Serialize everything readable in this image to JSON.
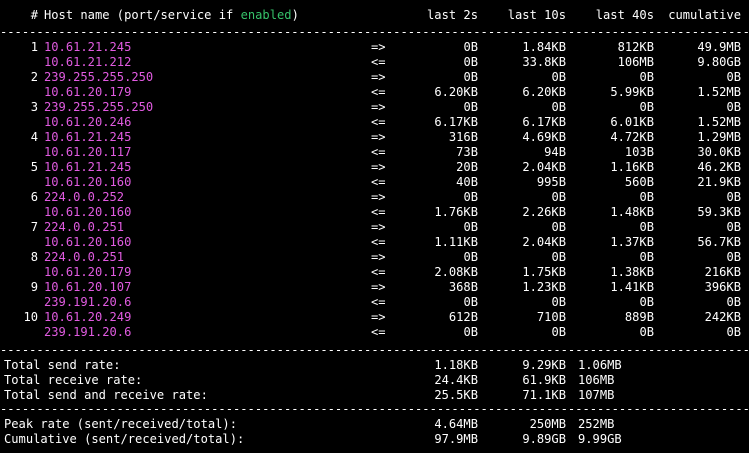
{
  "colors": {
    "background": "#000000",
    "text": "#ffffff",
    "host": "#e05be0",
    "enabled": "#36c26a"
  },
  "header": {
    "num_label": "#",
    "host_label_prefix": "Host name (port/service if ",
    "host_label_enabled": "enabled",
    "host_label_suffix": ")",
    "col_2s": "last 2s",
    "col_10s": "last 10s",
    "col_40s": "last 40s",
    "col_cum": "cumulative"
  },
  "separator": "--------------------------------------------------------------------------------------------------------------------------------------------",
  "connections": [
    {
      "num": "1",
      "src": {
        "host": "10.61.21.245",
        "dir": "=>",
        "l2": "0B",
        "l10": "1.84KB",
        "l40": "812KB",
        "cum": "49.9MB"
      },
      "dst": {
        "host": "10.61.21.212",
        "dir": "<=",
        "l2": "0B",
        "l10": "33.8KB",
        "l40": "106MB",
        "cum": "9.80GB"
      }
    },
    {
      "num": "2",
      "src": {
        "host": "239.255.255.250",
        "dir": "=>",
        "l2": "0B",
        "l10": "0B",
        "l40": "0B",
        "cum": "0B"
      },
      "dst": {
        "host": "10.61.20.179",
        "dir": "<=",
        "l2": "6.20KB",
        "l10": "6.20KB",
        "l40": "5.99KB",
        "cum": "1.52MB"
      }
    },
    {
      "num": "3",
      "src": {
        "host": "239.255.255.250",
        "dir": "=>",
        "l2": "0B",
        "l10": "0B",
        "l40": "0B",
        "cum": "0B"
      },
      "dst": {
        "host": "10.61.20.246",
        "dir": "<=",
        "l2": "6.17KB",
        "l10": "6.17KB",
        "l40": "6.01KB",
        "cum": "1.52MB"
      }
    },
    {
      "num": "4",
      "src": {
        "host": "10.61.21.245",
        "dir": "=>",
        "l2": "316B",
        "l10": "4.69KB",
        "l40": "4.72KB",
        "cum": "1.29MB"
      },
      "dst": {
        "host": "10.61.20.117",
        "dir": "<=",
        "l2": "73B",
        "l10": "94B",
        "l40": "103B",
        "cum": "30.0KB"
      }
    },
    {
      "num": "5",
      "src": {
        "host": "10.61.21.245",
        "dir": "=>",
        "l2": "20B",
        "l10": "2.04KB",
        "l40": "1.16KB",
        "cum": "46.2KB"
      },
      "dst": {
        "host": "10.61.20.160",
        "dir": "<=",
        "l2": "40B",
        "l10": "995B",
        "l40": "560B",
        "cum": "21.9KB"
      }
    },
    {
      "num": "6",
      "src": {
        "host": "224.0.0.252",
        "dir": "=>",
        "l2": "0B",
        "l10": "0B",
        "l40": "0B",
        "cum": "0B"
      },
      "dst": {
        "host": "10.61.20.160",
        "dir": "<=",
        "l2": "1.76KB",
        "l10": "2.26KB",
        "l40": "1.48KB",
        "cum": "59.3KB"
      }
    },
    {
      "num": "7",
      "src": {
        "host": "224.0.0.251",
        "dir": "=>",
        "l2": "0B",
        "l10": "0B",
        "l40": "0B",
        "cum": "0B"
      },
      "dst": {
        "host": "10.61.20.160",
        "dir": "<=",
        "l2": "1.11KB",
        "l10": "2.04KB",
        "l40": "1.37KB",
        "cum": "56.7KB"
      }
    },
    {
      "num": "8",
      "src": {
        "host": "224.0.0.251",
        "dir": "=>",
        "l2": "0B",
        "l10": "0B",
        "l40": "0B",
        "cum": "0B"
      },
      "dst": {
        "host": "10.61.20.179",
        "dir": "<=",
        "l2": "2.08KB",
        "l10": "1.75KB",
        "l40": "1.38KB",
        "cum": "216KB"
      }
    },
    {
      "num": "9",
      "src": {
        "host": "10.61.20.107",
        "dir": "=>",
        "l2": "368B",
        "l10": "1.23KB",
        "l40": "1.41KB",
        "cum": "396KB"
      },
      "dst": {
        "host": "239.191.20.6",
        "dir": "<=",
        "l2": "0B",
        "l10": "0B",
        "l40": "0B",
        "cum": "0B"
      }
    },
    {
      "num": "10",
      "src": {
        "host": "10.61.20.249",
        "dir": "=>",
        "l2": "612B",
        "l10": "710B",
        "l40": "889B",
        "cum": "242KB"
      },
      "dst": {
        "host": "239.191.20.6",
        "dir": "<=",
        "l2": "0B",
        "l10": "0B",
        "l40": "0B",
        "cum": "0B"
      }
    }
  ],
  "totals": [
    {
      "label": "Total send rate:",
      "l2": "1.18KB",
      "l10": "9.29KB",
      "l40": "1.06MB"
    },
    {
      "label": "Total receive rate:",
      "l2": "24.4KB",
      "l10": "61.9KB",
      "l40": "106MB"
    },
    {
      "label": "Total send and receive rate:",
      "l2": "25.5KB",
      "l10": "71.1KB",
      "l40": "107MB"
    }
  ],
  "peaks": [
    {
      "label": "Peak rate (sent/received/total):",
      "l2": "4.64MB",
      "l10": "250MB",
      "l40": "252MB"
    },
    {
      "label": "Cumulative (sent/received/total):",
      "l2": "97.9MB",
      "l10": "9.89GB",
      "l40": "9.99GB"
    }
  ]
}
